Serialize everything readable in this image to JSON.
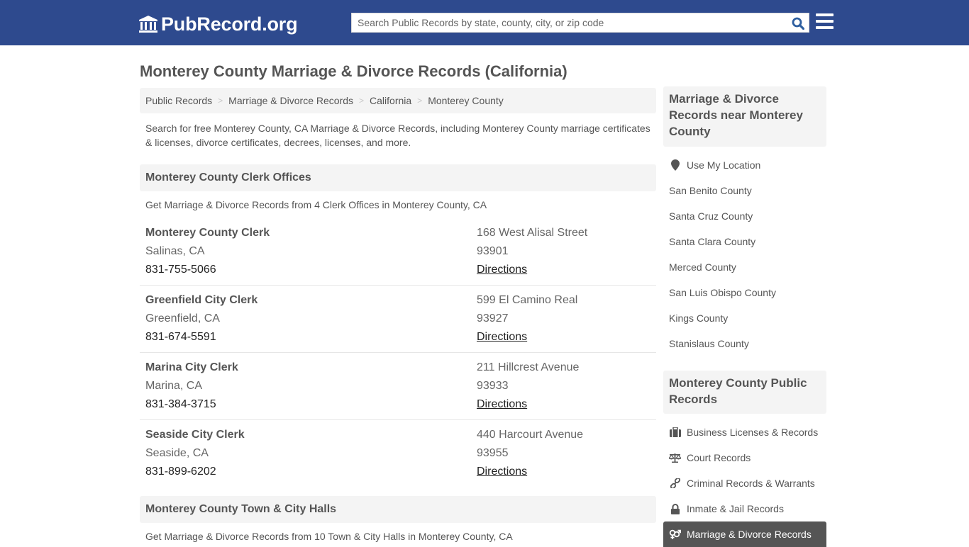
{
  "header": {
    "logo_text": "PubRecord.org",
    "search_placeholder": "Search Public Records by state, county, city, or zip code",
    "colors": {
      "brand": "#2e4a8e",
      "search_icon": "#2e5fa0"
    }
  },
  "page": {
    "title": "Monterey County Marriage & Divorce Records (California)",
    "breadcrumb": [
      "Public Records",
      "Marriage & Divorce Records",
      "California",
      "Monterey County"
    ],
    "intro": "Search for free Monterey County, CA Marriage & Divorce Records, including Monterey County marriage certificates & licenses, divorce certificates, decrees, licenses, and more."
  },
  "clerk_section": {
    "heading": "Monterey County Clerk Offices",
    "subtitle": "Get Marriage & Divorce Records from 4 Clerk Offices in Monterey County, CA",
    "offices": [
      {
        "name": "Monterey County Clerk",
        "city": "Salinas, CA",
        "phone": "831-755-5066",
        "address": "168 West Alisal Street",
        "zip": "93901",
        "link": "Directions"
      },
      {
        "name": "Greenfield City Clerk",
        "city": "Greenfield, CA",
        "phone": "831-674-5591",
        "address": "599 El Camino Real",
        "zip": "93927",
        "link": "Directions"
      },
      {
        "name": "Marina City Clerk",
        "city": "Marina, CA",
        "phone": "831-384-3715",
        "address": "211 Hillcrest Avenue",
        "zip": "93933",
        "link": "Directions"
      },
      {
        "name": "Seaside City Clerk",
        "city": "Seaside, CA",
        "phone": "831-899-6202",
        "address": "440 Harcourt Avenue",
        "zip": "93955",
        "link": "Directions"
      }
    ]
  },
  "halls_section": {
    "heading": "Monterey County Town & City Halls",
    "subtitle": "Get Marriage & Divorce Records from 10 Town & City Halls in Monterey County, CA"
  },
  "sidebar": {
    "nearby": {
      "heading": "Marriage & Divorce Records near Monterey County",
      "location_label": "Use My Location",
      "counties": [
        "San Benito County",
        "Santa Cruz County",
        "Santa Clara County",
        "Merced County",
        "San Luis Obispo County",
        "Kings County",
        "Stanislaus County"
      ]
    },
    "public_records": {
      "heading": "Monterey County Public Records",
      "items": [
        {
          "label": "Business Licenses & Records",
          "icon": "briefcase-icon"
        },
        {
          "label": "Court Records",
          "icon": "scales-icon"
        },
        {
          "label": "Criminal Records & Warrants",
          "icon": "link-icon"
        },
        {
          "label": "Inmate & Jail Records",
          "icon": "lock-icon"
        },
        {
          "label": "Marriage & Divorce Records",
          "icon": "genders-icon",
          "active": true
        }
      ]
    }
  }
}
